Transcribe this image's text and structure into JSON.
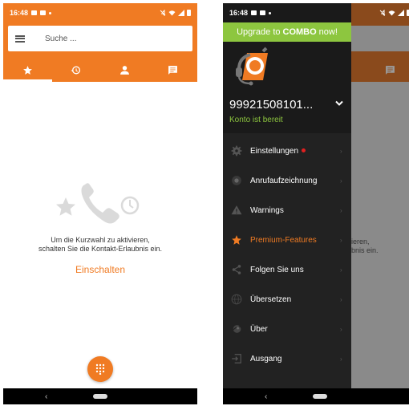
{
  "status_bar": {
    "time": "16:48"
  },
  "left": {
    "search": {
      "placeholder": "Suche ..."
    },
    "tabs": [
      {
        "name": "favorites",
        "icon": "star-icon"
      },
      {
        "name": "history",
        "icon": "history-icon"
      },
      {
        "name": "contacts",
        "icon": "person-icon"
      },
      {
        "name": "messages",
        "icon": "chat-icon"
      }
    ],
    "empty_state": {
      "line1": "Um die Kurzwahl zu aktivieren,",
      "line2": "schalten Sie die Kontakt-Erlaubnis ein.",
      "action": "Einschalten"
    }
  },
  "right": {
    "upgrade": {
      "prefix": "Upgrade to",
      "brand": "COMBO",
      "suffix": "now!"
    },
    "account": {
      "number": "99921508101...",
      "status": "Konto ist bereit"
    },
    "behind_text": {
      "line1": "ieren,",
      "line2": "bnis ein."
    },
    "menu": [
      {
        "label": "Einstellungen",
        "icon": "gear-icon",
        "badge": true
      },
      {
        "label": "Anrufaufzeichnung",
        "icon": "record-icon"
      },
      {
        "label": "Warnings",
        "icon": "warning-icon"
      },
      {
        "label": "Premium-Features",
        "icon": "star-icon",
        "highlight": true
      },
      {
        "label": "Folgen Sie uns",
        "icon": "share-icon"
      },
      {
        "label": "Übersetzen",
        "icon": "globe-icon"
      },
      {
        "label": "Über",
        "icon": "about-icon"
      },
      {
        "label": "Ausgang",
        "icon": "exit-icon"
      }
    ]
  },
  "colors": {
    "accent": "#f07b23",
    "green": "#8dc63f",
    "drawer": "#222222"
  }
}
